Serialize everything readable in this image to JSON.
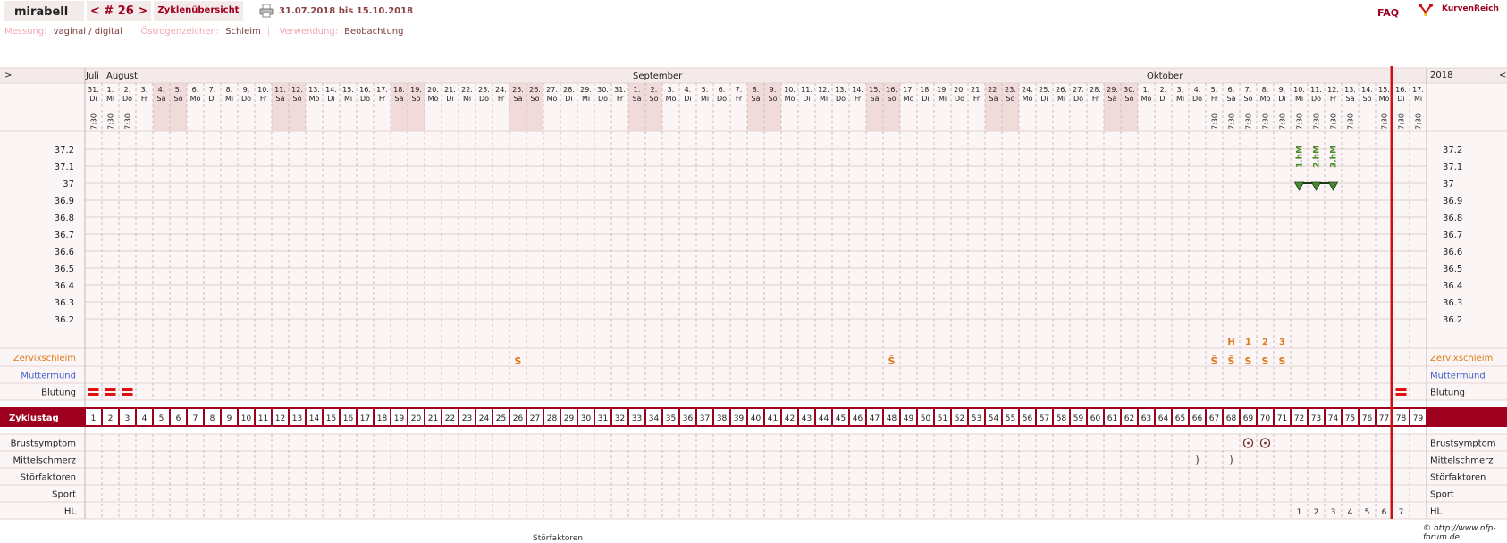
{
  "app": {
    "user": "mirabell",
    "cycle_nav": "< # 26 >",
    "tab_label": "Zyklenübersicht",
    "date_range": "31.07.2018 bis 15.10.2018",
    "faq": "FAQ",
    "logo_text": "KurvenReich"
  },
  "meta": [
    {
      "label": "Messung:",
      "value": "vaginal / digital"
    },
    {
      "label": "Östrogenzeichen:",
      "value": "Schleim"
    },
    {
      "label": "Verwendung:",
      "value": "Beobachtung"
    }
  ],
  "nav": {
    "prev": ">",
    "next": "<",
    "year": "2018"
  },
  "months": [
    {
      "label": "Juli",
      "col": 0
    },
    {
      "label": "August",
      "col": 1
    },
    {
      "label": "September",
      "col": 32
    },
    {
      "label": "Oktober",
      "col": 62
    }
  ],
  "days": [
    {
      "d": "31.",
      "w": "Di"
    },
    {
      "d": "1.",
      "w": "Mi"
    },
    {
      "d": "2.",
      "w": "Do"
    },
    {
      "d": "3.",
      "w": "Fr"
    },
    {
      "d": "4.",
      "w": "Sa"
    },
    {
      "d": "5.",
      "w": "So"
    },
    {
      "d": "6.",
      "w": "Mo"
    },
    {
      "d": "7.",
      "w": "Di"
    },
    {
      "d": "8.",
      "w": "Mi"
    },
    {
      "d": "9.",
      "w": "Do"
    },
    {
      "d": "10.",
      "w": "Fr"
    },
    {
      "d": "11.",
      "w": "Sa"
    },
    {
      "d": "12.",
      "w": "So"
    },
    {
      "d": "13.",
      "w": "Mo"
    },
    {
      "d": "14.",
      "w": "Di"
    },
    {
      "d": "15.",
      "w": "Mi"
    },
    {
      "d": "16.",
      "w": "Do"
    },
    {
      "d": "17.",
      "w": "Fr"
    },
    {
      "d": "18.",
      "w": "Sa"
    },
    {
      "d": "19.",
      "w": "So"
    },
    {
      "d": "20.",
      "w": "Mo"
    },
    {
      "d": "21.",
      "w": "Di"
    },
    {
      "d": "22.",
      "w": "Mi"
    },
    {
      "d": "23.",
      "w": "Do"
    },
    {
      "d": "24.",
      "w": "Fr"
    },
    {
      "d": "25.",
      "w": "Sa"
    },
    {
      "d": "26.",
      "w": "So"
    },
    {
      "d": "27.",
      "w": "Mo"
    },
    {
      "d": "28.",
      "w": "Di"
    },
    {
      "d": "29.",
      "w": "Mi"
    },
    {
      "d": "30.",
      "w": "Do"
    },
    {
      "d": "31.",
      "w": "Fr"
    },
    {
      "d": "1.",
      "w": "Sa"
    },
    {
      "d": "2.",
      "w": "So"
    },
    {
      "d": "3.",
      "w": "Mo"
    },
    {
      "d": "4.",
      "w": "Di"
    },
    {
      "d": "5.",
      "w": "Mi"
    },
    {
      "d": "6.",
      "w": "Do"
    },
    {
      "d": "7.",
      "w": "Fr"
    },
    {
      "d": "8.",
      "w": "Sa"
    },
    {
      "d": "9.",
      "w": "So"
    },
    {
      "d": "10.",
      "w": "Mo"
    },
    {
      "d": "11.",
      "w": "Di"
    },
    {
      "d": "12.",
      "w": "Mi"
    },
    {
      "d": "13.",
      "w": "Do"
    },
    {
      "d": "14.",
      "w": "Fr"
    },
    {
      "d": "15.",
      "w": "Sa"
    },
    {
      "d": "16.",
      "w": "So"
    },
    {
      "d": "17.",
      "w": "Mo"
    },
    {
      "d": "18.",
      "w": "Di"
    },
    {
      "d": "19.",
      "w": "Mi"
    },
    {
      "d": "20.",
      "w": "Do"
    },
    {
      "d": "21.",
      "w": "Fr"
    },
    {
      "d": "22.",
      "w": "Sa"
    },
    {
      "d": "23.",
      "w": "So"
    },
    {
      "d": "24.",
      "w": "Mo"
    },
    {
      "d": "25.",
      "w": "Di"
    },
    {
      "d": "26.",
      "w": "Mi"
    },
    {
      "d": "27.",
      "w": "Do"
    },
    {
      "d": "28.",
      "w": "Fr"
    },
    {
      "d": "29.",
      "w": "Sa"
    },
    {
      "d": "30.",
      "w": "So"
    },
    {
      "d": "1.",
      "w": "Mo"
    },
    {
      "d": "2.",
      "w": "Di"
    },
    {
      "d": "3.",
      "w": "Mi"
    },
    {
      "d": "4.",
      "w": "Do"
    },
    {
      "d": "5.",
      "w": "Fr"
    },
    {
      "d": "6.",
      "w": "Sa"
    },
    {
      "d": "7.",
      "w": "So"
    },
    {
      "d": "8.",
      "w": "Mo"
    },
    {
      "d": "9.",
      "w": "Di"
    },
    {
      "d": "10.",
      "w": "Mi"
    },
    {
      "d": "11.",
      "w": "Do"
    },
    {
      "d": "12.",
      "w": "Fr"
    },
    {
      "d": "13.",
      "w": "Sa"
    },
    {
      "d": "14.",
      "w": "So"
    },
    {
      "d": "15.",
      "w": "Mo"
    },
    {
      "d": "16.",
      "w": "Di"
    },
    {
      "d": "17.",
      "w": "Mi"
    }
  ],
  "weekend_cols": [
    4,
    5,
    11,
    12,
    18,
    19,
    25,
    26,
    32,
    33,
    39,
    40,
    46,
    47,
    53,
    54,
    60,
    61
  ],
  "measure_time": "7:30",
  "measure_cols": [
    0,
    1,
    2,
    66,
    67,
    68,
    69,
    70,
    71,
    72,
    73,
    74,
    76,
    77,
    78
  ],
  "temps": {
    "labels": [
      "37.2",
      "37.1",
      "37",
      "36.9",
      "36.8",
      "36.7",
      "36.6",
      "36.5",
      "36.4",
      "36.3",
      "36.2"
    ],
    "values": [
      37.2,
      37.1,
      37.0,
      36.9,
      36.8,
      36.7,
      36.6,
      36.5,
      36.4,
      36.3,
      36.2
    ]
  },
  "coverline": {
    "cols": [
      71,
      73
    ],
    "value": 37.0
  },
  "hm_labels": [
    {
      "col": 71,
      "text": "1.hM"
    },
    {
      "col": 72,
      "text": "2.hM"
    },
    {
      "col": 73,
      "text": "3.hM"
    }
  ],
  "rows": {
    "zervix": "Zervixschleim",
    "muttermund": "Muttermund",
    "blutung": "Blutung",
    "zyklustag": "Zyklustag",
    "brust": "Brustsymptom",
    "mittel": "Mittelschmerz",
    "stoer": "Störfaktoren",
    "sport": "Sport",
    "hl": "HL"
  },
  "mucus": [
    {
      "col": 25,
      "sym": "S"
    },
    {
      "col": 47,
      "sym": "Ŝ"
    },
    {
      "col": 66,
      "sym": "Ŝ"
    },
    {
      "col": 67,
      "sym": "Ŝ"
    },
    {
      "col": 68,
      "sym": "S"
    },
    {
      "col": 69,
      "sym": "S"
    },
    {
      "col": 70,
      "sym": "S"
    }
  ],
  "peak_markers": [
    {
      "col": 67,
      "text": "H"
    },
    {
      "col": 68,
      "text": "1"
    },
    {
      "col": 69,
      "text": "2"
    },
    {
      "col": 70,
      "text": "3"
    }
  ],
  "bleeding_cols": [
    0,
    1,
    2,
    77
  ],
  "breast_cols": [
    68,
    69
  ],
  "mittel_cols": [
    65,
    67
  ],
  "hl": [
    {
      "col": 71,
      "t": "1"
    },
    {
      "col": 72,
      "t": "2"
    },
    {
      "col": 73,
      "t": "3"
    },
    {
      "col": 74,
      "t": "4"
    },
    {
      "col": 75,
      "t": "5"
    },
    {
      "col": 76,
      "t": "6"
    },
    {
      "col": 77,
      "t": "7"
    }
  ],
  "cycle_days": [
    "1",
    "2",
    "3",
    "4",
    "5",
    "6",
    "7",
    "8",
    "9",
    "10",
    "11",
    "12",
    "13",
    "14",
    "15",
    "16",
    "17",
    "18",
    "19",
    "20",
    "21",
    "22",
    "23",
    "24",
    "25",
    "26",
    "27",
    "28",
    "29",
    "30",
    "31",
    "32",
    "33",
    "34",
    "35",
    "36",
    "37",
    "38",
    "39",
    "40",
    "41",
    "42",
    "43",
    "44",
    "45",
    "46",
    "47",
    "48",
    "49",
    "50",
    "51",
    "52",
    "53",
    "54",
    "55",
    "56",
    "57",
    "58",
    "59",
    "60",
    "61",
    "62",
    "63",
    "64",
    "65",
    "66",
    "67",
    "68",
    "69",
    "70",
    "71",
    "72",
    "73",
    "74",
    "75",
    "76",
    "77",
    "78",
    "79"
  ],
  "colors": {
    "accent": "#a00020",
    "orange": "#e07818",
    "blue": "#4060c8",
    "green": "#4a8a2a",
    "today": "#cc1111"
  },
  "copyright": "© http://www.nfp-forum.de",
  "footer_cut": "Störfaktoren"
}
